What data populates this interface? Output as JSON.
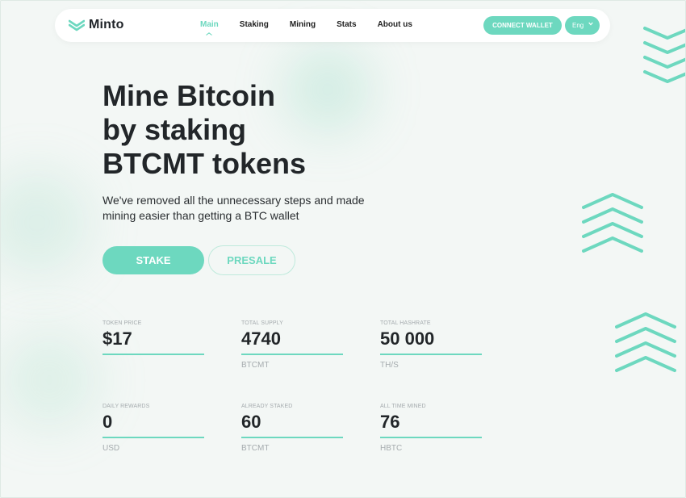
{
  "header": {
    "brand": "Minto",
    "nav": [
      {
        "label": "Main",
        "active": true
      },
      {
        "label": "Staking",
        "active": false
      },
      {
        "label": "Mining",
        "active": false
      },
      {
        "label": "Stats",
        "active": false
      },
      {
        "label": "About us",
        "active": false
      }
    ],
    "connect_wallet_label": "CONNECT WALLET",
    "language": "Eng"
  },
  "hero": {
    "title": "Mine Bitcoin\nby staking\nBTCMT tokens",
    "subtitle": "We've removed all the unnecessary steps and made\nmining easier than getting a BTC wallet",
    "stake_label": "STAKE",
    "presale_label": "PRESALE"
  },
  "stats": [
    {
      "label": "TOKEN PRICE",
      "value": "$17",
      "unit": ""
    },
    {
      "label": "TOTAL SUPPLY",
      "value": "4740",
      "unit": "BTCMT"
    },
    {
      "label": "TOTAL HASHRATE",
      "value": "50 000",
      "unit": "TH/S"
    },
    {
      "label": "DAILY REWARDS",
      "value": "0",
      "unit": "USD"
    },
    {
      "label": "ALREADY STAKED",
      "value": "60",
      "unit": "BTCMT"
    },
    {
      "label": "ALL TIME MINED",
      "value": "76",
      "unit": "HBTC"
    }
  ],
  "colors": {
    "accent": "#6dd8bf",
    "text": "#222629",
    "muted": "#a5abae",
    "background": "#f3f7f5"
  },
  "icons": {
    "logo": "minto-logo-icon",
    "language_dropdown": "chevron-down-icon",
    "active_nav_marker": "caret-up-icon",
    "decorations": "chevrons-icon"
  }
}
